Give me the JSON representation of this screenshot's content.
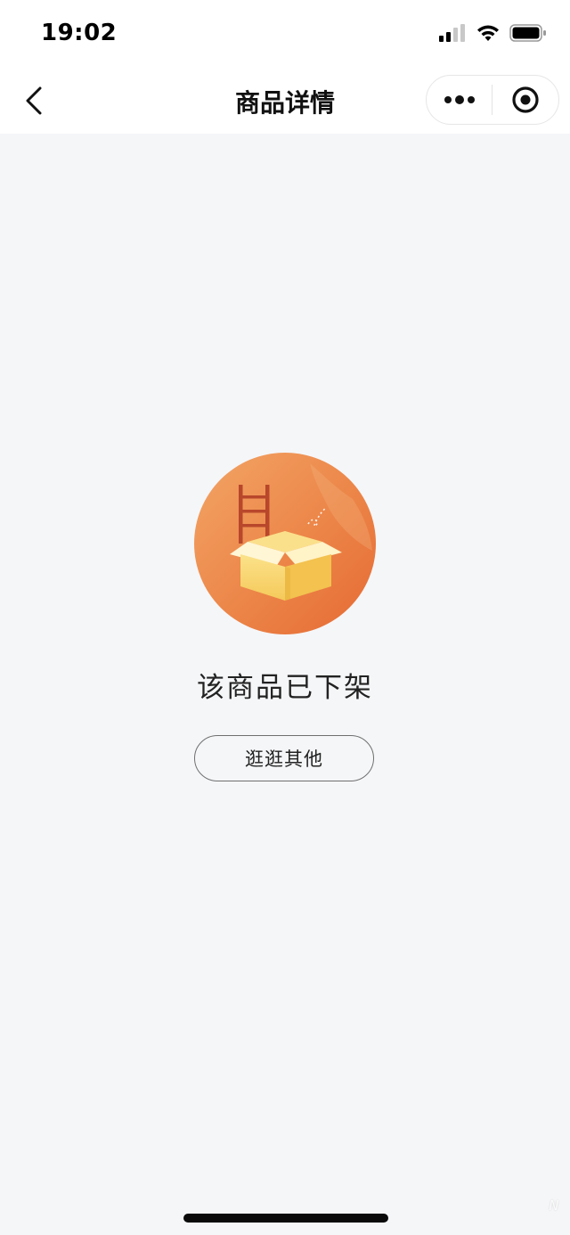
{
  "status_bar": {
    "time": "19:02",
    "icons": [
      "signal-icon",
      "wifi-icon",
      "battery-icon"
    ]
  },
  "nav": {
    "title": "商品详情",
    "back_icon": "chevron-left-icon",
    "more_icon": "more-dots-icon",
    "close_icon": "target-close-icon"
  },
  "main": {
    "illustration": "empty-box-ladder-icon",
    "message": "该商品已下架",
    "browse_button_label": "逛逛其他"
  },
  "watermark": {
    "text": "N"
  },
  "colors": {
    "background": "#f5f6f8",
    "nav_background": "#ffffff",
    "illustration_orange": "#ea8044",
    "box_yellow": "#f7d869",
    "ladder": "#b8472b"
  }
}
